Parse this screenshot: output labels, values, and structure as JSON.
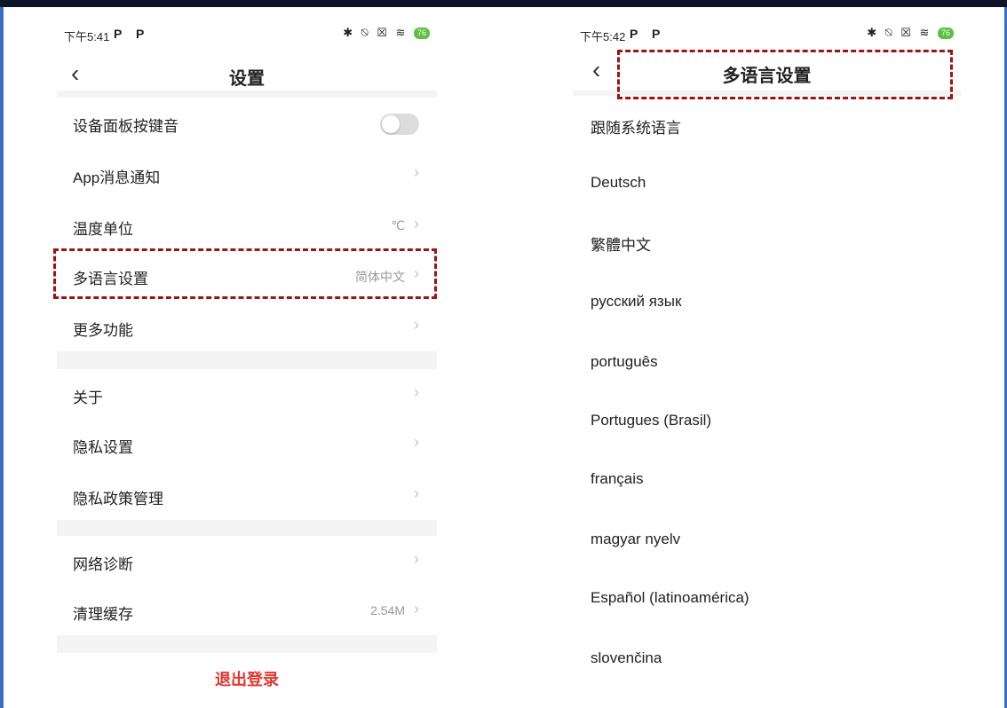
{
  "left_screen": {
    "status": {
      "time": "下午5:41",
      "p_icons": "P P",
      "right_icons": "✱ ⍉ ☒ ≋",
      "battery": "76"
    },
    "header": {
      "title": "设置"
    },
    "rows": [
      {
        "label": "设备面板按键音",
        "value": ""
      },
      {
        "label": "App消息通知",
        "value": ""
      },
      {
        "label": "温度单位",
        "value": "℃"
      },
      {
        "label": "多语言设置",
        "value": "简体中文"
      },
      {
        "label": "更多功能",
        "value": ""
      },
      {
        "label": "关于",
        "value": ""
      },
      {
        "label": "隐私设置",
        "value": ""
      },
      {
        "label": "隐私政策管理",
        "value": ""
      },
      {
        "label": "网络诊断",
        "value": ""
      },
      {
        "label": "清理缓存",
        "value": "2.54M"
      }
    ],
    "toggle_state": "off",
    "logout_label": "退出登录"
  },
  "right_screen": {
    "status": {
      "time": "下午5:42",
      "p_icons": "P P",
      "right_icons": "✱ ⍉ ☒ ≋",
      "battery": "76"
    },
    "header": {
      "title": "多语言设置"
    },
    "languages": [
      "跟随系统语言",
      "Deutsch",
      "繁體中文",
      "русский язык",
      "português",
      "Portugues (Brasil)",
      "français",
      "magyar nyelv",
      "Español (latinoamérica)",
      "slovenčina"
    ]
  },
  "icons": {
    "back": "chevron-left-icon",
    "row_arrow": "chevron-right-icon",
    "toggle": "switch-icon"
  },
  "colors": {
    "accent_red": "#e2372f",
    "highlight_dash": "#a31212",
    "frame_blue": "#3b6fc4",
    "divider_gray": "#f4f4f4"
  }
}
